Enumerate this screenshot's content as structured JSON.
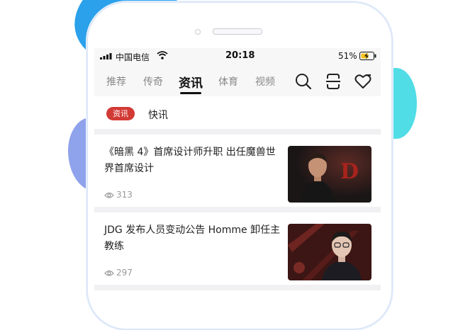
{
  "status_bar": {
    "carrier": "中国电信",
    "time": "20:18",
    "battery_percent": "51%",
    "signal_icon": "cellular-signal-icon",
    "wifi_icon": "wifi-icon",
    "battery_icon": "battery-charging-icon"
  },
  "tabs": [
    {
      "label": "推荐",
      "active": false
    },
    {
      "label": "传奇",
      "active": false
    },
    {
      "label": "资讯",
      "active": true
    },
    {
      "label": "体育",
      "active": false
    },
    {
      "label": "视频",
      "active": false
    }
  ],
  "toolbar_icons": [
    "search-icon",
    "scan-icon",
    "heart-plus-icon"
  ],
  "subnav": {
    "tag": "资讯",
    "tab": "快讯"
  },
  "articles": [
    {
      "title": "《暗黑 4》首席设计师升职 出任魔兽世界首席设计",
      "views": "313",
      "thumb_mark": "D"
    },
    {
      "title": "JDG 发布人员变动公告 Homme 卸任主教练",
      "views": "297"
    }
  ],
  "colors": {
    "accent_red": "#d23a35",
    "blob_blue": "#2aa1ea",
    "blob_cyan": "#50dde6",
    "blob_purple": "#8fa2ec"
  }
}
